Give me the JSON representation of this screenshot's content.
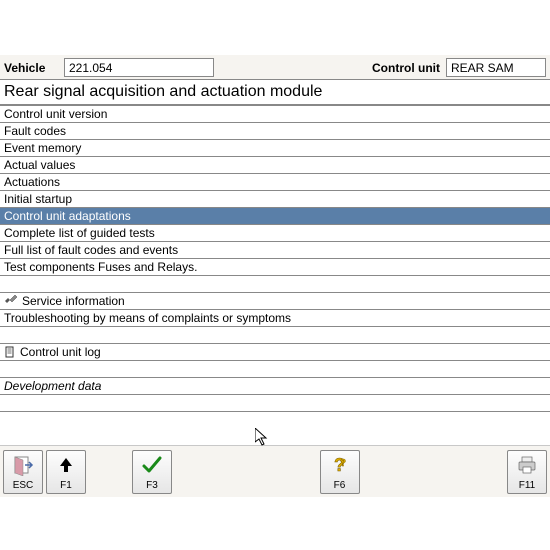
{
  "header": {
    "vehicle_label": "Vehicle",
    "vehicle_value": "221.054",
    "control_unit_label": "Control unit",
    "control_unit_value": "REAR SAM"
  },
  "title": "Rear signal acquisition and actuation module",
  "menu": {
    "items": [
      {
        "label": "Control unit version"
      },
      {
        "label": "Fault codes"
      },
      {
        "label": "Event memory"
      },
      {
        "label": "Actual values"
      },
      {
        "label": "Actuations"
      },
      {
        "label": "Initial startup"
      },
      {
        "label": "Control unit adaptations",
        "selected": true
      },
      {
        "label": "Complete list of guided tests"
      },
      {
        "label": "Full list of fault codes and events"
      },
      {
        "label": "Test components Fuses and Relays."
      }
    ],
    "section2": [
      {
        "label": "Service information",
        "icon": "tool"
      },
      {
        "label": "Troubleshooting by means of complaints or symptoms"
      }
    ],
    "section3": [
      {
        "label": "Control unit log",
        "icon": "doc"
      }
    ],
    "section4": [
      {
        "label": "Development data",
        "italic": true
      }
    ]
  },
  "fkeys": {
    "esc": "ESC",
    "f1": "F1",
    "f3": "F3",
    "f6": "F6",
    "f11": "F11"
  }
}
